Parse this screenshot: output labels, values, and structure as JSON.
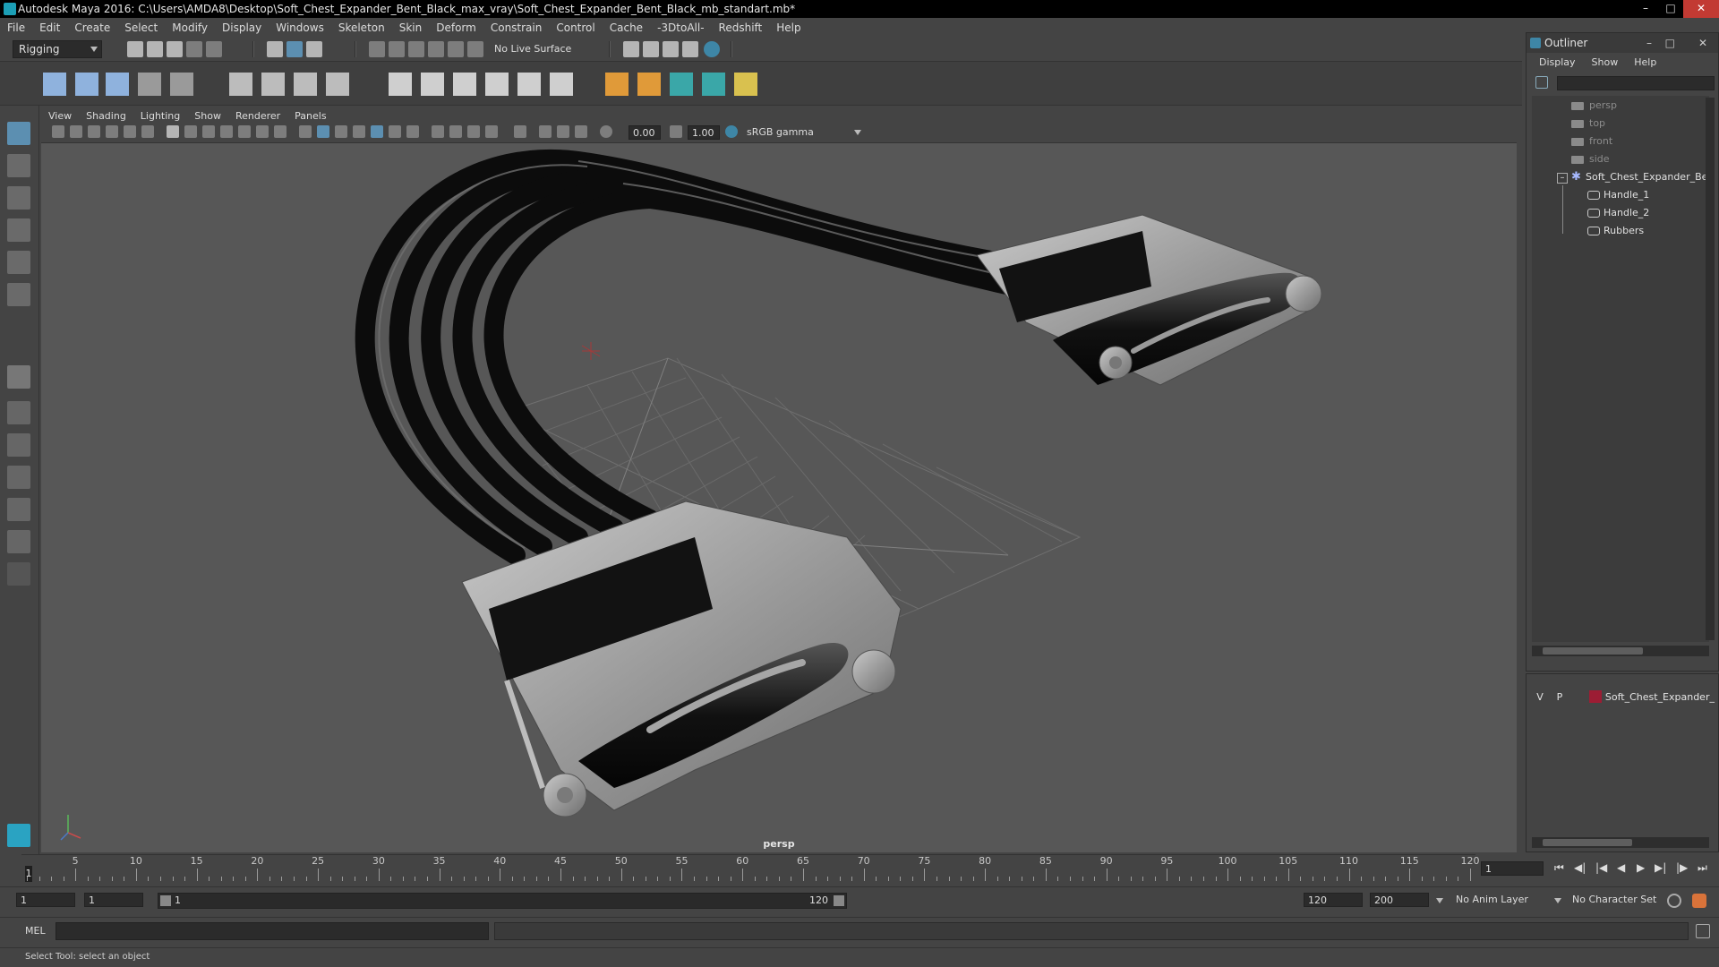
{
  "window": {
    "title": "Autodesk Maya 2016: C:\\Users\\AMDA8\\Desktop\\Soft_Chest_Expander_Bent_Black_max_vray\\Soft_Chest_Expander_Bent_Black_mb_standart.mb*"
  },
  "menubar": [
    "File",
    "Edit",
    "Create",
    "Select",
    "Modify",
    "Display",
    "Windows",
    "Skeleton",
    "Skin",
    "Deform",
    "Constrain",
    "Control",
    "Cache",
    "-3DtoAll-",
    "Redshift",
    "Help"
  ],
  "statusline": {
    "menuset": "Rigging",
    "live_surface": "No Live Surface"
  },
  "viewport": {
    "menu": [
      "View",
      "Shading",
      "Lighting",
      "Show",
      "Renderer",
      "Panels"
    ],
    "exposure": "0.00",
    "gamma": "1.00",
    "color_space": "sRGB gamma",
    "camera_label": "persp"
  },
  "outliner": {
    "title": "Outliner",
    "menu": [
      "Display",
      "Show",
      "Help"
    ],
    "cameras": [
      "persp",
      "top",
      "front",
      "side"
    ],
    "group": "Soft_Chest_Expander_Be",
    "children": [
      "Handle_1",
      "Handle_2",
      "Rubbers"
    ]
  },
  "layers": {
    "visible": "V",
    "playback": "P",
    "name": "Soft_Chest_Expander_",
    "color": "#9c1d34"
  },
  "timeline": {
    "ticks": [
      "5",
      "10",
      "15",
      "20",
      "25",
      "30",
      "35",
      "40",
      "45",
      "50",
      "55",
      "60",
      "65",
      "70",
      "75",
      "80",
      "85",
      "90",
      "95",
      "100",
      "105",
      "110",
      "115",
      "120"
    ],
    "start_label": "1",
    "current_frame": "1"
  },
  "range": {
    "start": "1",
    "playback_start": "1",
    "slider_start": "1",
    "slider_end": "120",
    "playback_end": "120",
    "end": "200",
    "anim_layer": "No Anim Layer",
    "character_set": "No Character Set"
  },
  "command": {
    "language": "MEL"
  },
  "help": {
    "text": "Select Tool: select an object"
  }
}
